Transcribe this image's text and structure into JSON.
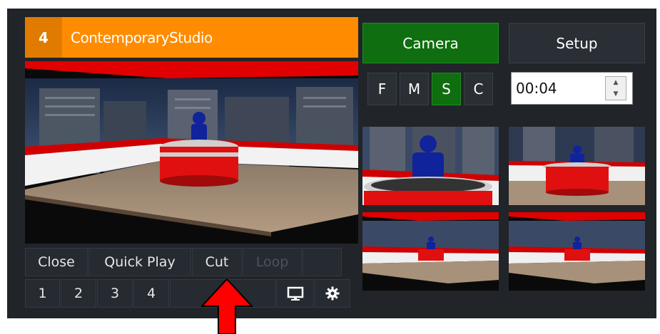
{
  "header": {
    "number": "4",
    "title": "ContemporaryStudio"
  },
  "controls": {
    "close": "Close",
    "quick_play": "Quick Play",
    "cut": "Cut",
    "loop": "Loop",
    "inputs": [
      "1",
      "2",
      "3",
      "4"
    ]
  },
  "tabs": {
    "camera": "Camera",
    "setup": "Setup"
  },
  "shots": [
    "F",
    "M",
    "S",
    "C"
  ],
  "active_shot": "S",
  "duration": "00:04",
  "colors": {
    "accent_orange": "#ff8c00",
    "active_green": "#0f6e0f",
    "panel_bg": "#212429",
    "arrow_red": "#ff0000"
  },
  "icons": [
    "monitor-icon",
    "gear-icon",
    "spinner-up-icon",
    "spinner-down-icon",
    "red-arrow-icon"
  ]
}
